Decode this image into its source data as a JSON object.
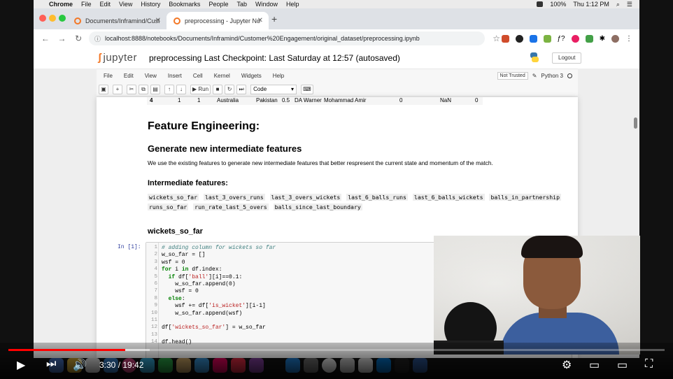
{
  "menubar": {
    "app": "Chrome",
    "items": [
      "File",
      "Edit",
      "View",
      "History",
      "Bookmarks",
      "People",
      "Tab",
      "Window",
      "Help"
    ],
    "battery": "100%",
    "clock": "Thu 1:12 PM"
  },
  "browser": {
    "tabs": [
      {
        "title": "Documents/Inframind/Customer"
      },
      {
        "title": "preprocessing - Jupyter Notebook"
      }
    ],
    "url": "localhost:8888/notebooks/Documents/Inframind/Customer%20Engagement/original_dataset/preprocessing.ipynb"
  },
  "jupyter": {
    "logo": "jupyter",
    "title": "preprocessing Last Checkpoint: Last Saturday at 12:57  (autosaved)",
    "logout": "Logout",
    "menu": [
      "File",
      "Edit",
      "View",
      "Insert",
      "Cell",
      "Kernel",
      "Widgets",
      "Help"
    ],
    "trust": "Not Trusted",
    "kernel": "Python 3",
    "run_label": "Run",
    "cell_type": "Code"
  },
  "df_row": [
    "4",
    "1",
    "1",
    "Australia",
    "Pakistan",
    "0.5",
    "DA Warner",
    "Mohammad Amir",
    "0",
    "NaN",
    "0"
  ],
  "notebook": {
    "h1": "Feature Engineering:",
    "h2": "Generate new intermediate features",
    "para": "We use the existing features to generate new intermediate features that better respresent the current state and momentum of the match.",
    "h3": "Intermediate features:",
    "features": [
      "wickets_so_far",
      "last_3_overs_runs",
      "last_3_overs_wickets",
      "last_6_balls_runs",
      "last_6_balls_wickets",
      "balls_in_partnership",
      "runs_so_far",
      "run_rate_last_5_overs",
      "balls_since_last_boundary"
    ],
    "h4": "wickets_so_far",
    "prompt": "In [1]:",
    "code": [
      "# adding column for wickets so far",
      "w_so_far = []",
      "wsf = 0",
      "for i in df.index:",
      "  if df['ball'][i]==0.1:",
      "    w_so_far.append(0)",
      "    wsf = 0",
      "  else:",
      "    wsf += df['is_wicket'][i-1]",
      "    w_so_far.append(wsf)",
      "",
      "df['wickets_so_far'] = w_so_far",
      "",
      "df.head()"
    ]
  },
  "player": {
    "time": "3:30 / 19:42",
    "progress_fraction": 0.178,
    "buffer_fraction": 0.215
  }
}
